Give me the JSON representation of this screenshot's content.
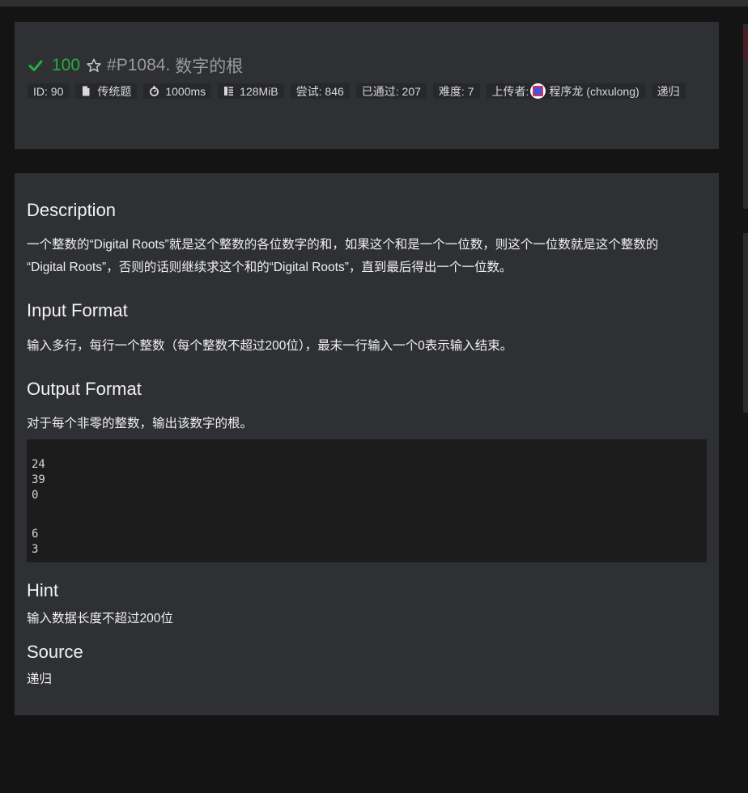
{
  "problem": {
    "score": "100",
    "pid": "#P1084.",
    "name": "数字的根",
    "tags": [
      {
        "icon": "id",
        "text": "ID: 90"
      },
      {
        "icon": "file-icon",
        "text": "传统题"
      },
      {
        "icon": "stopwatch-icon",
        "text": "1000ms"
      },
      {
        "icon": "memory-icon",
        "text": "128MiB"
      },
      {
        "icon": "",
        "text": "尝试: 846"
      },
      {
        "icon": "",
        "text": "已通过: 207"
      },
      {
        "icon": "",
        "text": "难度: 7"
      }
    ],
    "uploader_label": "上传者:",
    "uploader_name": "程序龙 (chxulong)",
    "category_tag": "递归",
    "score_color": "#25ad40"
  },
  "content": {
    "description_title": "Description",
    "description_line1": "一个整数的“Digital Roots”就是这个整数的各位数字的和，如果这个和是一个一位数，则这个一位数就是这个整数的",
    "description_line2": "“Digital Roots”，否则的话则继续求这个和的“Digital Roots”，直到最后得出一个一位数。",
    "input_title": "Input Format",
    "input_text": "输入多行，每行一个整数（每个整数不超过200位），最末一行输入一个0表示输入结束。",
    "output_title": "Output Format",
    "output_text": "对于每个非零的整数，输出该数字的根。",
    "sample": [
      "24",
      "39",
      "0",
      "",
      "",
      "6",
      "3"
    ],
    "hint_title": "Hint",
    "hint_text": "输入数据长度不超过200位",
    "source_title": "Source",
    "source_text": "递归"
  }
}
